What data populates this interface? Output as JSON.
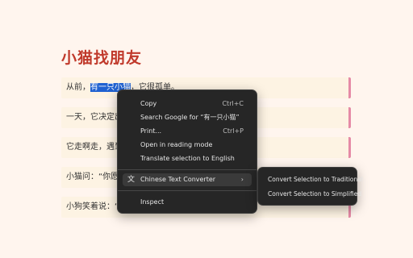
{
  "page": {
    "title": "小猫找朋友",
    "paragraphs": [
      {
        "before": "从前，",
        "selected": "有一只小猫",
        "after": "，它很孤单。"
      },
      {
        "text": "一天，它决定出去找朋友。"
      },
      {
        "text": "它走啊走，遇到了一只小狗。"
      },
      {
        "text": "小猫问：“你愿意做我的朋友吗？”"
      },
      {
        "text": "小狗笑着说：“当然愿意！”"
      }
    ]
  },
  "context_menu": {
    "copy": {
      "label": "Copy",
      "shortcut": "Ctrl+C"
    },
    "search": {
      "label": "Search Google for “有一只小猫”"
    },
    "print": {
      "label": "Print...",
      "shortcut": "Ctrl+P"
    },
    "reading_mode": {
      "label": "Open in reading mode"
    },
    "translate": {
      "label": "Translate selection to English"
    },
    "converter": {
      "label": "Chinese Text Converter",
      "icon": "文",
      "arrow": "›"
    },
    "inspect": {
      "label": "Inspect"
    }
  },
  "submenu": {
    "traditional": "Convert Selection to Traditional",
    "simplified": "Convert Selection to Simplified"
  },
  "colors": {
    "title": "#c0392b",
    "selection": "#1f61d1",
    "accent_border": "#e58aa6",
    "menu_bg": "#262626"
  }
}
